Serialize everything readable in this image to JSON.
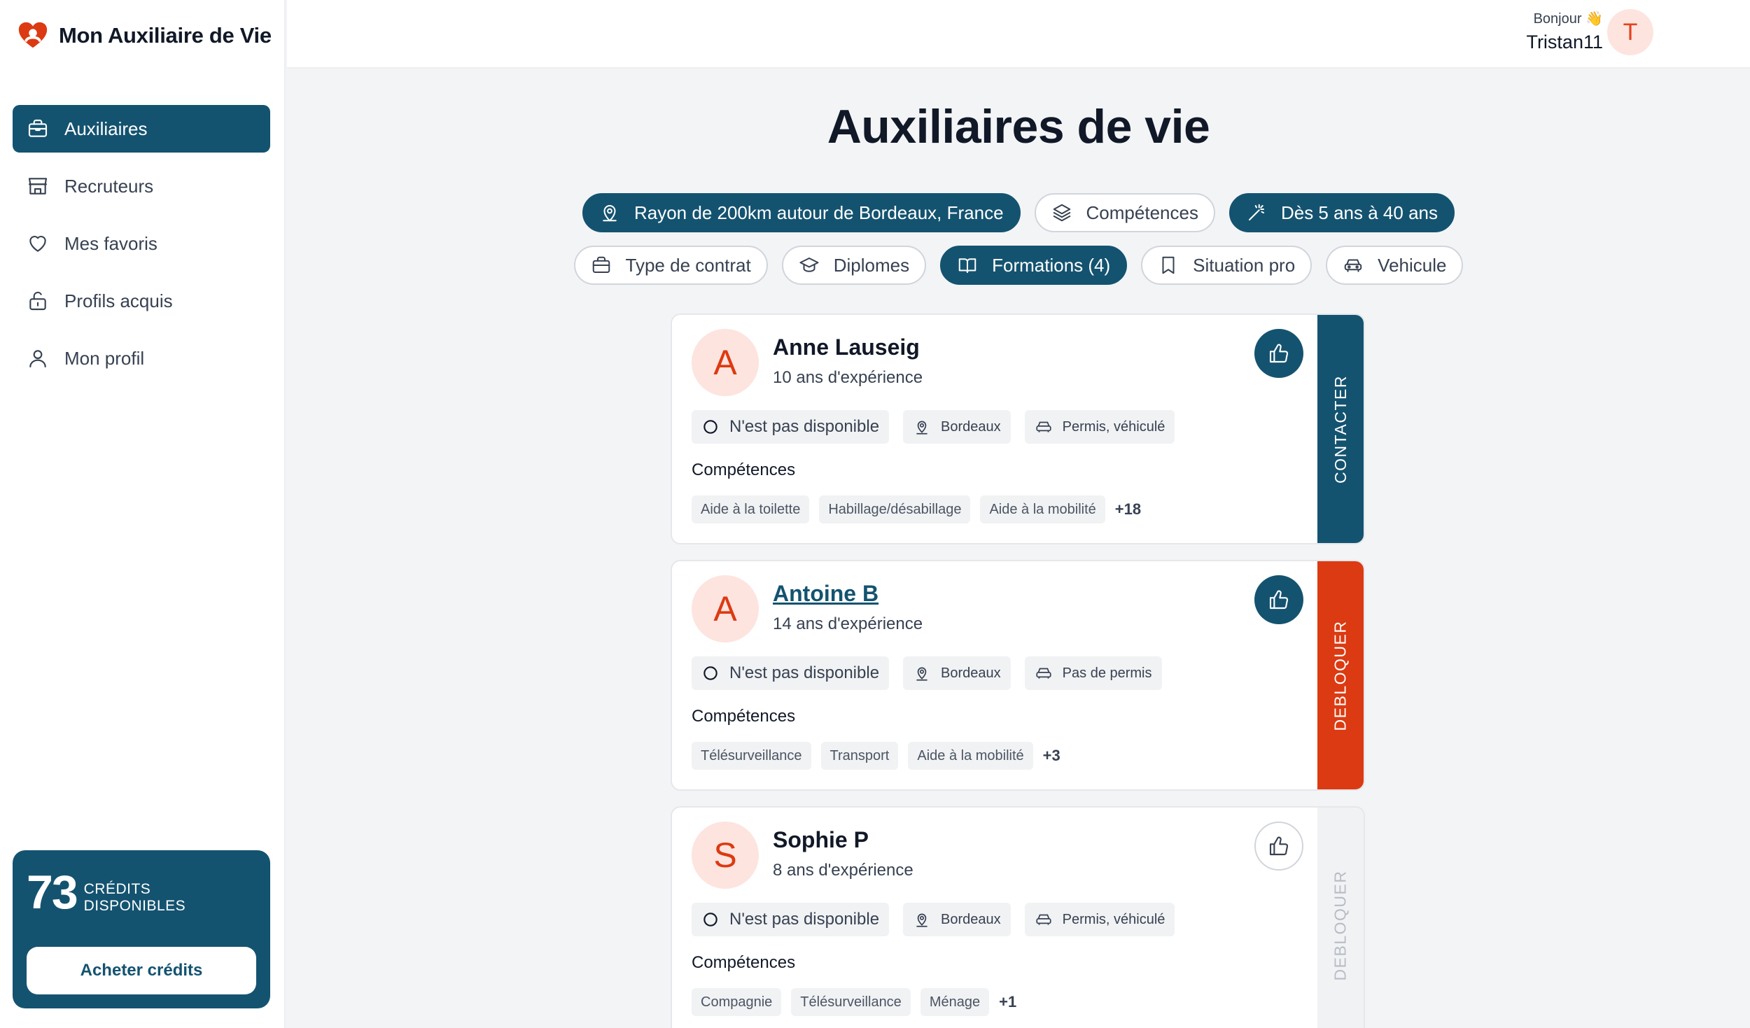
{
  "brand": {
    "name": "Mon Auxiliaire de Vie"
  },
  "sidebar": {
    "items": [
      {
        "label": "Auxiliaires",
        "icon": "briefcase-icon",
        "active": true
      },
      {
        "label": "Recruteurs",
        "icon": "store-icon"
      },
      {
        "label": "Mes favoris",
        "icon": "heart-icon"
      },
      {
        "label": "Profils acquis",
        "icon": "lock-open-icon"
      },
      {
        "label": "Mon profil",
        "icon": "user-icon"
      }
    ],
    "credits": {
      "count": "73",
      "label": "CRÉDITS DISPONIBLES",
      "button": "Acheter crédits"
    }
  },
  "header": {
    "greeting": "Bonjour 👋",
    "username": "Tristan11",
    "avatar_letter": "T"
  },
  "main": {
    "title": "Auxiliaires de vie",
    "filters": {
      "location": "Rayon de 200km autour de Bordeaux, France",
      "skills": "Compétences",
      "experience": "Dès 5 ans à 40 ans",
      "contract": "Type de contrat",
      "diplomas": "Diplomes",
      "trainings": "Formations (4)",
      "situation": "Situation pro",
      "vehicle": "Vehicule"
    },
    "cards": [
      {
        "initial": "A",
        "name": "Anne Lauseig",
        "experience": "10 ans d'expérience",
        "availability": "N'est pas disponible",
        "city": "Bordeaux",
        "license": "Permis, véhiculé",
        "skills_title": "Compétences",
        "skills": [
          "Aide à la toilette",
          "Habillage/désabillage",
          "Aide à la mobilité"
        ],
        "more": "+18",
        "action": "CONTACTER"
      },
      {
        "initial": "A",
        "name": "Antoine B",
        "experience": "14 ans d'expérience",
        "availability": "N'est pas disponible",
        "city": "Bordeaux",
        "license": "Pas de permis",
        "skills_title": "Compétences",
        "skills": [
          "Télésurveillance",
          "Transport",
          "Aide à la mobilité"
        ],
        "more": "+3",
        "action": "DEBLOQUER"
      },
      {
        "initial": "S",
        "name": "Sophie P",
        "experience": "8 ans d'expérience",
        "availability": "N'est pas disponible",
        "city": "Bordeaux",
        "license": "Permis, véhiculé",
        "skills_title": "Compétences",
        "skills": [
          "Compagnie",
          "Télésurveillance",
          "Ménage"
        ],
        "more": "+1",
        "action": "DEBLOQUER"
      }
    ]
  },
  "colors": {
    "primary": "#145370",
    "accent": "#dc3a12",
    "avatar_bg": "#fde4df"
  }
}
